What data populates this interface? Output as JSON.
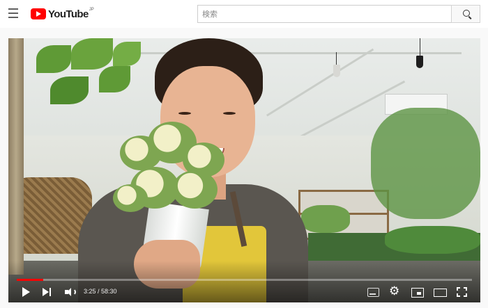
{
  "header": {
    "logo_text": "YouTube",
    "logo_country": "JP",
    "search_placeholder": "検索",
    "menu_icon": "hamburger-menu-icon",
    "search_icon": "search-icon"
  },
  "player": {
    "current_time": "3:25",
    "duration": "58:30",
    "time_display": "3:25 / 58:30",
    "progress_fraction": 0.0584,
    "progress_color": "#ff0000",
    "controls": {
      "play": "play-icon",
      "next": "next-icon",
      "volume": "volume-icon",
      "captions": "captions-icon",
      "settings": "gear-icon",
      "miniplayer": "miniplayer-icon",
      "theater": "theater-mode-icon",
      "fullscreen": "fullscreen-icon"
    }
  },
  "colors": {
    "brand_red": "#ff0000",
    "header_bg": "#ffffff",
    "page_bg": "#f9f9f9"
  }
}
